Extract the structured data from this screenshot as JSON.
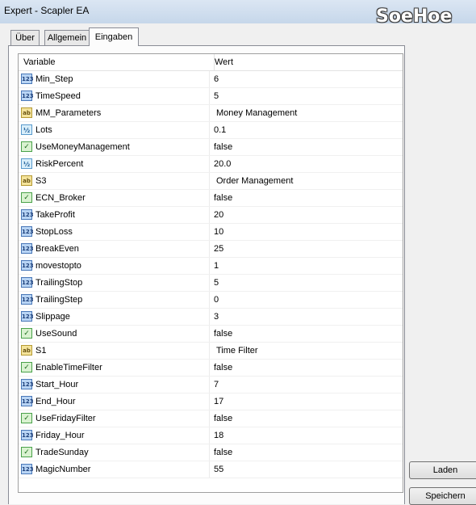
{
  "window": {
    "title": "Expert - Scapler EA",
    "logo": "SoeHoe"
  },
  "tabs": [
    {
      "label": "Über",
      "active": false
    },
    {
      "label": "Allgemein",
      "active": false
    },
    {
      "label": "Eingaben",
      "active": true
    }
  ],
  "table": {
    "headers": {
      "variable": "Variable",
      "value": "Wert"
    },
    "rows": [
      {
        "name": "Min_Step",
        "value": "6",
        "type": "int",
        "icon_text": "123"
      },
      {
        "name": "TimeSpeed",
        "value": "5",
        "type": "int",
        "icon_text": "123"
      },
      {
        "name": "MM_Parameters",
        "value": "Money Management",
        "type": "string",
        "icon_text": "ab"
      },
      {
        "name": "Lots",
        "value": "0.1",
        "type": "double",
        "icon_text": "½"
      },
      {
        "name": "UseMoneyManagement",
        "value": "false",
        "type": "bool",
        "icon_text": "✓"
      },
      {
        "name": "RiskPercent",
        "value": "20.0",
        "type": "double",
        "icon_text": "½"
      },
      {
        "name": "S3",
        "value": "Order Management",
        "type": "string",
        "icon_text": "ab"
      },
      {
        "name": "ECN_Broker",
        "value": "false",
        "type": "bool",
        "icon_text": "✓"
      },
      {
        "name": "TakeProfit",
        "value": "20",
        "type": "int",
        "icon_text": "123"
      },
      {
        "name": "StopLoss",
        "value": "10",
        "type": "int",
        "icon_text": "123"
      },
      {
        "name": "BreakEven",
        "value": "25",
        "type": "int",
        "icon_text": "123"
      },
      {
        "name": "movestopto",
        "value": "1",
        "type": "int",
        "icon_text": "123"
      },
      {
        "name": "TrailingStop",
        "value": "5",
        "type": "int",
        "icon_text": "123"
      },
      {
        "name": "TrailingStep",
        "value": "0",
        "type": "int",
        "icon_text": "123"
      },
      {
        "name": "Slippage",
        "value": "3",
        "type": "int",
        "icon_text": "123"
      },
      {
        "name": "UseSound",
        "value": "false",
        "type": "bool",
        "icon_text": "✓"
      },
      {
        "name": "S1",
        "value": "Time Filter",
        "type": "string",
        "icon_text": "ab"
      },
      {
        "name": "EnableTimeFilter",
        "value": "false",
        "type": "bool",
        "icon_text": "✓"
      },
      {
        "name": "Start_Hour",
        "value": "7",
        "type": "int",
        "icon_text": "123"
      },
      {
        "name": "End_Hour",
        "value": "17",
        "type": "int",
        "icon_text": "123"
      },
      {
        "name": "UseFridayFilter",
        "value": "false",
        "type": "bool",
        "icon_text": "✓"
      },
      {
        "name": "Friday_Hour",
        "value": "18",
        "type": "int",
        "icon_text": "123"
      },
      {
        "name": "TradeSunday",
        "value": "false",
        "type": "bool",
        "icon_text": "✓"
      },
      {
        "name": "MagicNumber",
        "value": "55",
        "type": "int",
        "icon_text": "123"
      }
    ]
  },
  "buttons": {
    "load": "Laden",
    "save": "Speichern"
  }
}
